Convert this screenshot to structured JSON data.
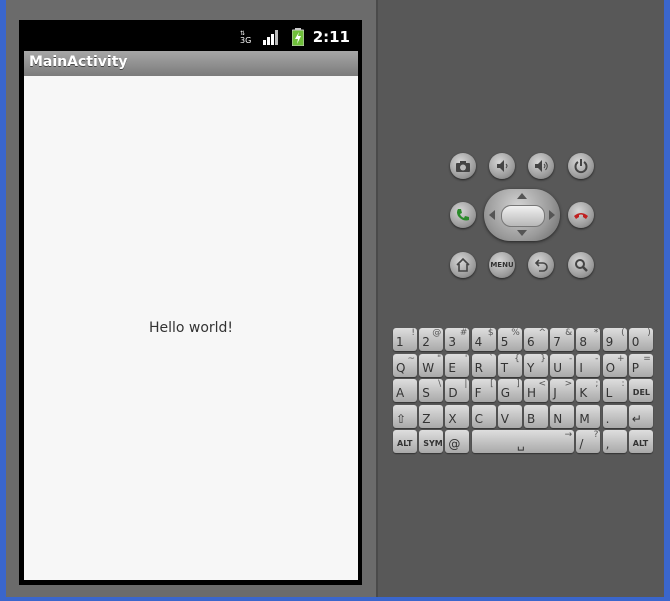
{
  "status_bar": {
    "network": "3G",
    "time": "2:11"
  },
  "app": {
    "title": "MainActivity",
    "message": "Hello world!"
  },
  "hw_buttons": {
    "row1": [
      "camera-icon",
      "volume-down-icon",
      "volume-up-icon",
      "power-icon"
    ],
    "call": "call-icon",
    "end_call": "end-call-icon",
    "row3": [
      "home-icon",
      "menu",
      "back-icon",
      "search-icon"
    ],
    "menu_label": "MENU"
  },
  "keyboard": {
    "rows": [
      [
        {
          "m": "1",
          "a": "!"
        },
        {
          "m": "2",
          "a": "@"
        },
        {
          "m": "3",
          "a": "#"
        },
        {
          "m": "4",
          "a": "$"
        },
        {
          "m": "5",
          "a": "%"
        },
        {
          "m": "6",
          "a": "^"
        },
        {
          "m": "7",
          "a": "&"
        },
        {
          "m": "8",
          "a": "*"
        },
        {
          "m": "9",
          "a": "("
        },
        {
          "m": "0",
          "a": ")"
        }
      ],
      [
        {
          "m": "Q",
          "a": "~"
        },
        {
          "m": "W",
          "a": "\""
        },
        {
          "m": "E",
          "a": "'"
        },
        {
          "m": "R",
          "a": "`"
        },
        {
          "m": "T",
          "a": "{"
        },
        {
          "m": "Y",
          "a": "}"
        },
        {
          "m": "U",
          "a": "-"
        },
        {
          "m": "I",
          "a": "-"
        },
        {
          "m": "O",
          "a": "+"
        },
        {
          "m": "P",
          "a": "="
        }
      ],
      [
        {
          "m": "A",
          "a": ""
        },
        {
          "m": "S",
          "a": "\\"
        },
        {
          "m": "D",
          "a": "|"
        },
        {
          "m": "F",
          "a": "["
        },
        {
          "m": "G",
          "a": "]"
        },
        {
          "m": "H",
          "a": "<"
        },
        {
          "m": "J",
          "a": ">"
        },
        {
          "m": "K",
          "a": ";"
        },
        {
          "m": "L",
          "a": ":"
        },
        {
          "m": "DEL",
          "a": ""
        }
      ],
      [
        {
          "m": "⇧",
          "a": ""
        },
        {
          "m": "Z",
          "a": ""
        },
        {
          "m": "X",
          "a": ""
        },
        {
          "m": "C",
          "a": ""
        },
        {
          "m": "V",
          "a": ""
        },
        {
          "m": "B",
          "a": ""
        },
        {
          "m": "N",
          "a": ""
        },
        {
          "m": "M",
          "a": ""
        },
        {
          "m": ".",
          "a": ""
        },
        {
          "m": "↵",
          "a": ""
        }
      ],
      [
        {
          "m": "ALT",
          "a": ""
        },
        {
          "m": "SYM",
          "a": ""
        },
        {
          "m": "@",
          "a": ""
        },
        {
          "m": "␣",
          "a": "→"
        },
        {
          "m": "/",
          "a": "?"
        },
        {
          "m": ",",
          "a": ""
        },
        {
          "m": "ALT",
          "a": ""
        }
      ]
    ]
  }
}
